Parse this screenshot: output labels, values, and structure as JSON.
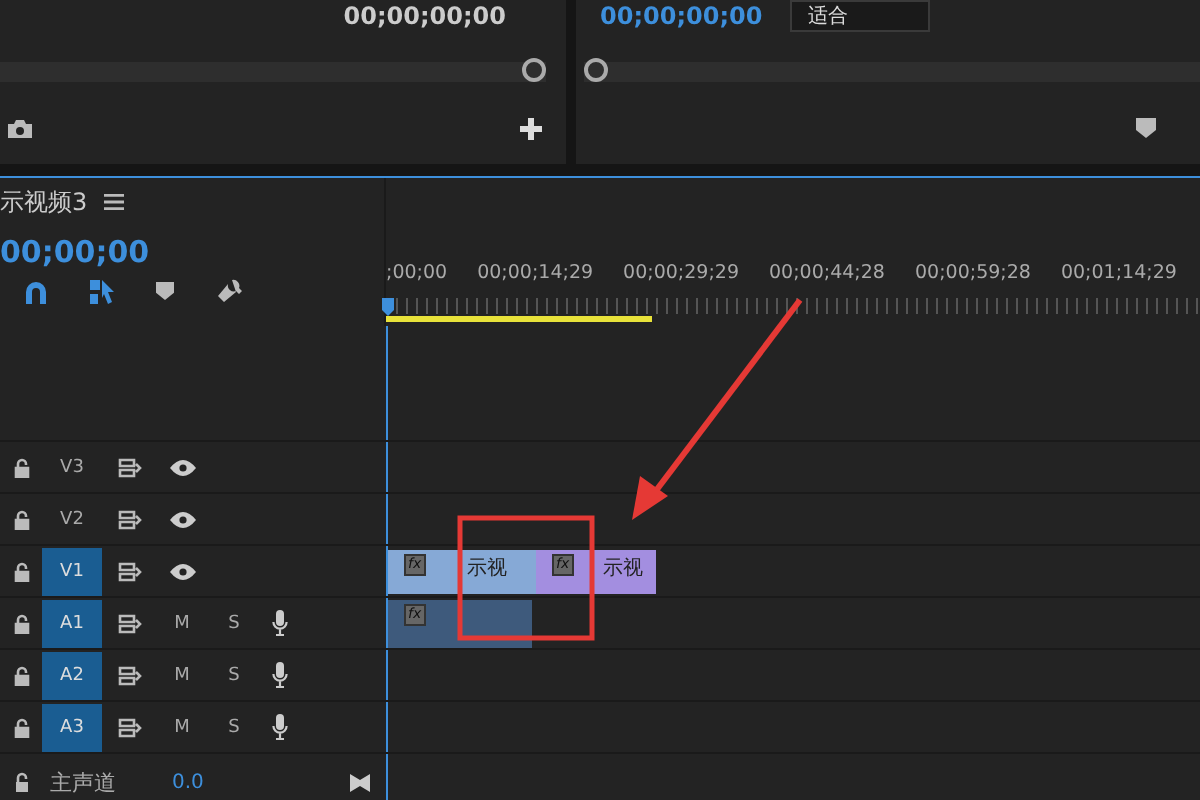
{
  "source_monitor": {
    "timecode": "00;00;00;00"
  },
  "program_monitor": {
    "timecode": "00;00;00;00",
    "zoom_dropdown": "适合"
  },
  "timeline": {
    "title": "示视频3",
    "timecode": "00;00;00",
    "ruler_labels": [
      ";00;00",
      "00;00;14;29",
      "00;00;29;29",
      "00;00;44;28",
      "00;00;59;28",
      "00;01;14;29"
    ],
    "tracks": [
      {
        "kind": "video",
        "name": "V3",
        "selected": false
      },
      {
        "kind": "video",
        "name": "V2",
        "selected": false
      },
      {
        "kind": "video",
        "name": "V1",
        "selected": true,
        "clips": [
          {
            "kind": "video",
            "badge": "fx",
            "label": "示视",
            "color": "#86a9d6"
          },
          {
            "kind": "video",
            "badge": "fx",
            "label": "示视",
            "color": "#a38ee0"
          }
        ]
      },
      {
        "kind": "audio",
        "name": "A1",
        "selected": true,
        "mute": "M",
        "solo": "S",
        "clips": [
          {
            "kind": "audio",
            "badge": "fx",
            "color": "#3e5a7c"
          }
        ]
      },
      {
        "kind": "audio",
        "name": "A2",
        "selected": true,
        "mute": "M",
        "solo": "S"
      },
      {
        "kind": "audio",
        "name": "A3",
        "selected": true,
        "mute": "M",
        "solo": "S"
      }
    ],
    "master": {
      "label": "主声道",
      "value": "0.0"
    }
  }
}
